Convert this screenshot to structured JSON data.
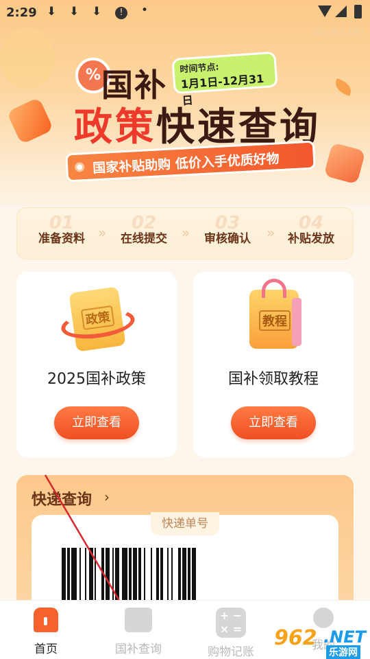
{
  "status_bar": {
    "time": "2:29",
    "dot": "•"
  },
  "watermark": "ID:d61389",
  "banner": {
    "badge_symbol": "%",
    "title_line1": "国补",
    "title_line2_red": "政策",
    "title_line2_dark": "快速查询",
    "date_label": "时间节点:",
    "date_value": "1月1日-12月31日",
    "slogan": "国家补贴助购 低价入手优质好物"
  },
  "steps": [
    {
      "num": "01",
      "label": "准备资料"
    },
    {
      "num": "02",
      "label": "在线提交"
    },
    {
      "num": "03",
      "label": "审核确认"
    },
    {
      "num": "04",
      "label": "补贴发放"
    }
  ],
  "cards": [
    {
      "image_text": "政策",
      "title": "2025国补政策",
      "button": "立即查看"
    },
    {
      "image_text": "教程",
      "title": "国补领取教程",
      "button": "立即查看"
    }
  ],
  "express": {
    "title": "快递查询",
    "chevron": "›",
    "tab": "快递单号"
  },
  "bottom_nav": [
    {
      "label": "首页",
      "active": true
    },
    {
      "label": "国补查询",
      "active": false
    },
    {
      "label": "购物记账",
      "active": false
    },
    {
      "label": "我的",
      "active": false
    }
  ],
  "calc_symbols": {
    "row1": "+ −",
    "row2": "× ="
  },
  "site_logo": {
    "part1": "962",
    "part2": ".NET",
    "part3": "乐游网"
  },
  "colors": {
    "accent": "#f5622e",
    "button": "#ef4f22",
    "title_red": "#ee3a2a",
    "lime": "#c8f26d"
  }
}
